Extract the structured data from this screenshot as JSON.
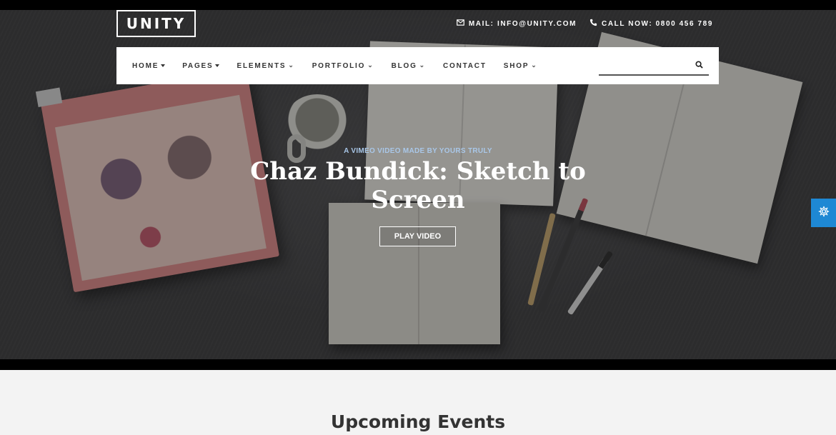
{
  "brand": {
    "logo_text": "UNITY"
  },
  "topbar": {
    "mail_label": "MAIL: INFO@UNITY.COM",
    "phone_label": "CALL NOW: 0800 456 789",
    "mail_icon": "envelope-icon",
    "phone_icon": "phone-icon"
  },
  "nav": {
    "items": [
      {
        "label": "HOME",
        "indicator": "caret"
      },
      {
        "label": "PAGES",
        "indicator": "caret"
      },
      {
        "label": "ELEMENTS",
        "indicator": "chevron"
      },
      {
        "label": "PORTFOLIO",
        "indicator": "chevron"
      },
      {
        "label": "BLOG",
        "indicator": "chevron"
      },
      {
        "label": "CONTACT",
        "indicator": "none"
      },
      {
        "label": "SHOP",
        "indicator": "chevron"
      }
    ],
    "search": {
      "placeholder": "",
      "value": "",
      "icon": "search-icon"
    }
  },
  "hero": {
    "eyebrow": "A VIMEO VIDEO MADE BY YOURS TRULY",
    "headline": "Chaz Bundick: Sketch to Screen",
    "cta_label": "PLAY VIDEO"
  },
  "settings_tab": {
    "icon": "gear-icon",
    "color": "#1e88d4"
  },
  "sections": {
    "upcoming_title": "Upcoming Events"
  },
  "colors": {
    "accent": "#1e88d4",
    "eyebrow": "#a9c7e8",
    "navbar_bg": "#ffffff"
  }
}
